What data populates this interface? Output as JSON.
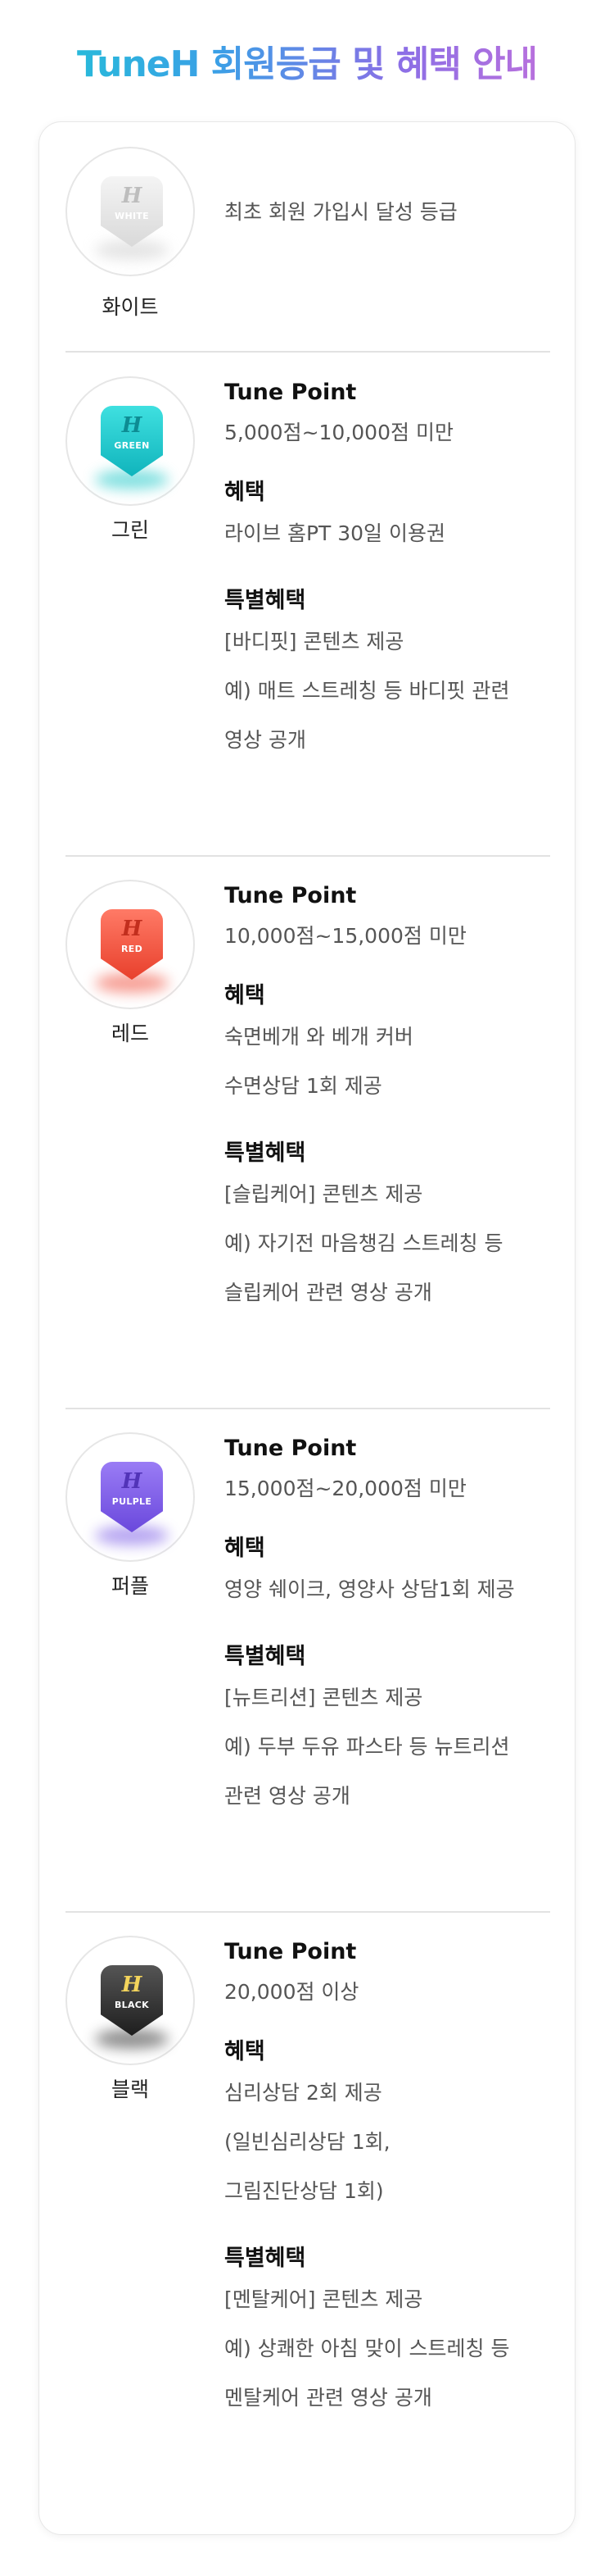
{
  "title": "TuneH 회원등급 및 혜택 안내",
  "grades": [
    {
      "key": "white",
      "badge_label": "WHITE",
      "name": "화이트",
      "color": "#e8e8e8",
      "description": "최초 회원 가입시 달성 등급"
    },
    {
      "key": "green",
      "badge_label": "GREEN",
      "name": "그린",
      "color": "#1fc8c8",
      "point_heading": "Tune Point",
      "point_range": "5,000점~10,000점 미만",
      "benefit_heading": "혜택",
      "benefits": [
        "라이브 홈PT 30일 이용권"
      ],
      "special_heading": "특별혜택",
      "special": [
        "[바디핏] 콘텐츠 제공",
        "예) 매트 스트레칭 등 바디핏 관련",
        "영상 공개"
      ]
    },
    {
      "key": "red",
      "badge_label": "RED",
      "name": "레드",
      "color": "#f0503e",
      "point_heading": "Tune Point",
      "point_range": "10,000점~15,000점 미만",
      "benefit_heading": "혜택",
      "benefits": [
        "숙면베개 와 베개 커버",
        "수면상담 1회 제공"
      ],
      "special_heading": "특별혜택",
      "special": [
        "[슬립케어] 콘텐츠 제공",
        "예) 자기전 마음챙김 스트레칭 등",
        "슬립케어 관련 영상 공개"
      ]
    },
    {
      "key": "purple",
      "badge_label": "PULPLE",
      "name": "퍼플",
      "color": "#7b5ce6",
      "point_heading": "Tune Point",
      "point_range": "15,000점~20,000점 미만",
      "benefit_heading": "혜택",
      "benefits": [
        "영양 쉐이크, 영양사 상담1회 제공"
      ],
      "special_heading": "특별혜택",
      "special": [
        "[뉴트리션] 콘텐츠 제공",
        "예) 두부 두유 파스타 등 뉴트리션",
        "관련 영상 공개"
      ]
    },
    {
      "key": "black",
      "badge_label": "BLACK",
      "name": "블랙",
      "color": "#333333",
      "point_heading": "Tune Point",
      "point_range": "20,000점 이상",
      "benefit_heading": "혜택",
      "benefits": [
        "심리상담 2회 제공",
        "(일빈심리상담 1회,",
        "그림진단상담 1회)"
      ],
      "special_heading": "특별혜택",
      "special": [
        "[멘탈케어] 콘텐츠 제공",
        "예) 상쾌한 아침 맞이 스트레칭 등",
        "멘탈케어 관련 영상 공개"
      ]
    }
  ]
}
